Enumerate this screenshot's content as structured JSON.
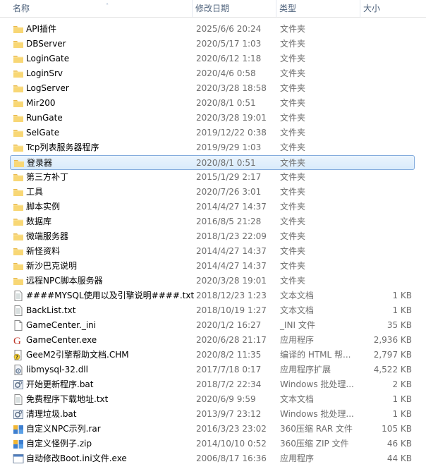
{
  "columns": {
    "name": "名称",
    "date": "修改日期",
    "type": "类型",
    "size": "大小"
  },
  "rows": [
    {
      "name": "API插件",
      "date": "2025/6/6 20:24",
      "type": "文件夹",
      "size": "",
      "icon": "folder-icon"
    },
    {
      "name": "DBServer",
      "date": "2020/5/17 1:03",
      "type": "文件夹",
      "size": "",
      "icon": "folder-icon"
    },
    {
      "name": "LoginGate",
      "date": "2020/6/12 1:18",
      "type": "文件夹",
      "size": "",
      "icon": "folder-icon"
    },
    {
      "name": "LoginSrv",
      "date": "2020/4/6 0:58",
      "type": "文件夹",
      "size": "",
      "icon": "folder-icon"
    },
    {
      "name": "LogServer",
      "date": "2020/3/28 18:58",
      "type": "文件夹",
      "size": "",
      "icon": "folder-icon"
    },
    {
      "name": "Mir200",
      "date": "2020/8/1 0:51",
      "type": "文件夹",
      "size": "",
      "icon": "folder-icon"
    },
    {
      "name": "RunGate",
      "date": "2020/3/28 19:01",
      "type": "文件夹",
      "size": "",
      "icon": "folder-icon"
    },
    {
      "name": "SelGate",
      "date": "2019/12/22 0:38",
      "type": "文件夹",
      "size": "",
      "icon": "folder-icon"
    },
    {
      "name": "Tcp列表服务器程序",
      "date": "2019/9/29 1:03",
      "type": "文件夹",
      "size": "",
      "icon": "folder-icon"
    },
    {
      "name": "登录器",
      "date": "2020/8/1 0:51",
      "type": "文件夹",
      "size": "",
      "icon": "folder-icon",
      "selected": true
    },
    {
      "name": "第三方补丁",
      "date": "2015/1/29 2:17",
      "type": "文件夹",
      "size": "",
      "icon": "folder-icon"
    },
    {
      "name": "工具",
      "date": "2020/7/26 3:01",
      "type": "文件夹",
      "size": "",
      "icon": "folder-icon"
    },
    {
      "name": "脚本实例",
      "date": "2014/4/27 14:37",
      "type": "文件夹",
      "size": "",
      "icon": "folder-icon"
    },
    {
      "name": "数据库",
      "date": "2016/8/5 21:28",
      "type": "文件夹",
      "size": "",
      "icon": "folder-icon"
    },
    {
      "name": "微端服务器",
      "date": "2018/1/23 22:09",
      "type": "文件夹",
      "size": "",
      "icon": "folder-icon"
    },
    {
      "name": "新怪资料",
      "date": "2014/4/27 14:37",
      "type": "文件夹",
      "size": "",
      "icon": "folder-icon"
    },
    {
      "name": "新沙巴克说明",
      "date": "2014/4/27 14:37",
      "type": "文件夹",
      "size": "",
      "icon": "folder-icon"
    },
    {
      "name": "远程NPC脚本服务器",
      "date": "2020/3/28 19:01",
      "type": "文件夹",
      "size": "",
      "icon": "folder-icon"
    },
    {
      "name": "####MYSQL使用以及引擎说明####.txt",
      "date": "2018/12/23 1:23",
      "type": "文本文档",
      "size": "1 KB",
      "icon": "text-file-icon"
    },
    {
      "name": "BackList.txt",
      "date": "2018/10/19 1:27",
      "type": "文本文档",
      "size": "1 KB",
      "icon": "text-file-icon"
    },
    {
      "name": "GameCenter._ini",
      "date": "2020/1/2 16:27",
      "type": "_INI 文件",
      "size": "35 KB",
      "icon": "blank-file-icon"
    },
    {
      "name": "GameCenter.exe",
      "date": "2020/6/28 21:17",
      "type": "应用程序",
      "size": "2,936 KB",
      "icon": "app-g-icon"
    },
    {
      "name": "GeeM2引擎帮助文档.CHM",
      "date": "2020/8/2 11:35",
      "type": "编译的 HTML 帮...",
      "size": "2,797 KB",
      "icon": "help-file-icon"
    },
    {
      "name": "libmysql-32.dll",
      "date": "2017/7/18 0:17",
      "type": "应用程序扩展",
      "size": "4,522 KB",
      "icon": "dll-file-icon"
    },
    {
      "name": "开始更新程序.bat",
      "date": "2018/7/2 22:34",
      "type": "Windows 批处理...",
      "size": "2 KB",
      "icon": "batch-file-icon"
    },
    {
      "name": "免费程序下载地址.txt",
      "date": "2020/6/9 9:59",
      "type": "文本文档",
      "size": "1 KB",
      "icon": "text-file-icon"
    },
    {
      "name": "清理垃圾.bat",
      "date": "2013/9/7 23:12",
      "type": "Windows 批处理...",
      "size": "1 KB",
      "icon": "batch-file-icon"
    },
    {
      "name": "自定义NPC示列.rar",
      "date": "2016/3/23 23:02",
      "type": "360压缩 RAR 文件",
      "size": "105 KB",
      "icon": "archive-icon"
    },
    {
      "name": "自定义怪例子.zip",
      "date": "2014/10/10 0:52",
      "type": "360压缩 ZIP 文件",
      "size": "46 KB",
      "icon": "archive-icon"
    },
    {
      "name": "自动修改Boot.ini文件.exe",
      "date": "2006/8/17 16:36",
      "type": "应用程序",
      "size": "44 KB",
      "icon": "app-icon"
    }
  ]
}
